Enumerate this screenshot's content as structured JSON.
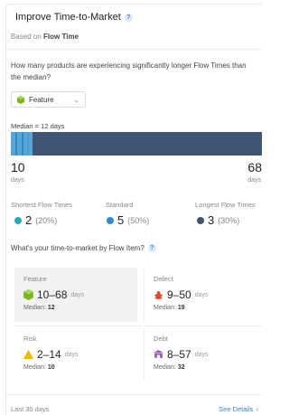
{
  "header": {
    "title": "Improve Time-to-Market",
    "help": "?",
    "subtitle_prefix": "Based on",
    "subtitle_value": "Flow Time"
  },
  "question": "How many products are experiencing significantly longer Flow Times than the median?",
  "dropdown": {
    "selected": "Feature",
    "icon": "feature-cube-icon"
  },
  "distribution": {
    "median_label": "Median = 12 days",
    "min": "10",
    "max": "68",
    "unit": "days",
    "colors": {
      "short": "#58a5d6",
      "long": "#3f5573"
    }
  },
  "categories": [
    {
      "label": "Shortest Flow Times",
      "count": "2",
      "pct": "(20%)",
      "color": "#2aa9b3"
    },
    {
      "label": "Standard",
      "count": "5",
      "pct": "(50%)",
      "color": "#2e8bd0"
    },
    {
      "label": "Longest Flow Times",
      "count": "3",
      "pct": "(30%)",
      "color": "#3f5573"
    }
  ],
  "question2": "What's your time-to-market by Flow Item?",
  "flow_items": [
    {
      "title": "Feature",
      "range": "10–68",
      "unit": "days",
      "median_label": "Median:",
      "median": "12",
      "icon": "feature-cube-icon",
      "color": "#7cb520",
      "selected": true
    },
    {
      "title": "Defect",
      "range": "9–50",
      "unit": "days",
      "median_label": "Median:",
      "median": "19",
      "icon": "bug-icon",
      "color": "#e0492e",
      "selected": false
    },
    {
      "title": "Risk",
      "range": "2–14",
      "unit": "days",
      "median_label": "Median:",
      "median": "10",
      "icon": "warning-triangle-icon",
      "color": "#f4b400",
      "selected": false
    },
    {
      "title": "Debt",
      "range": "8–57",
      "unit": "days",
      "median_label": "Median:",
      "median": "32",
      "icon": "debt-building-icon",
      "color": "#9b59b6",
      "selected": false
    }
  ],
  "footer": {
    "period": "Last 30 days",
    "link": "See Details",
    "chevron": "›"
  }
}
